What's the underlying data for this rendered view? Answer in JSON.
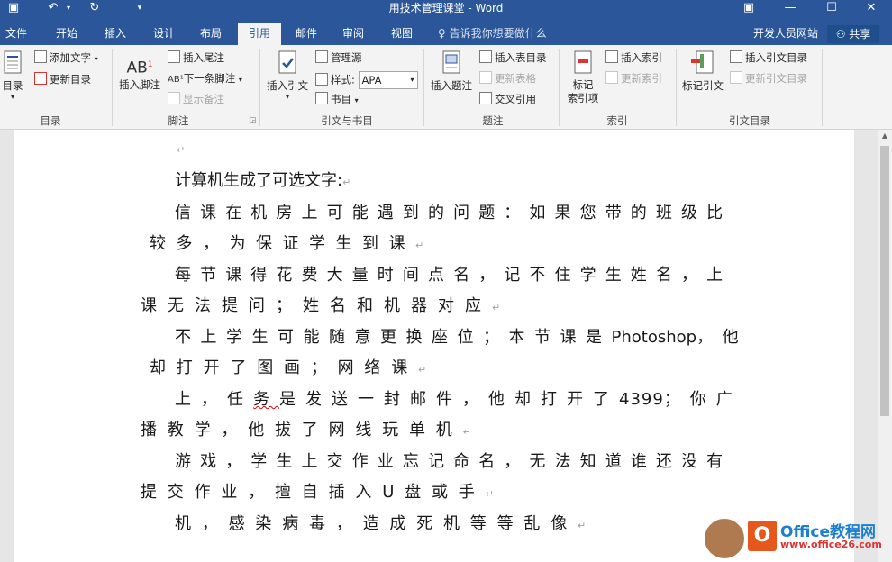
{
  "window": {
    "title": "用技术管理课堂 - Word",
    "minimize": "—",
    "restore": "☐",
    "close": "✕",
    "ribbon_display": "▣"
  },
  "tabs": {
    "file": "文件",
    "home": "开始",
    "insert": "插入",
    "design": "设计",
    "layout": "布局",
    "references": "引用",
    "mailings": "邮件",
    "review": "审阅",
    "view": "视图",
    "tell_me": "告诉我你想要做什么",
    "developer_site": "开发人员网站",
    "share": "共享"
  },
  "ribbon": {
    "toc": {
      "label": "目录",
      "toc_button": "目录",
      "add_text": "添加文字",
      "update_toc": "更新目录"
    },
    "footnotes": {
      "label": "脚注",
      "insert_footnote": "插入脚注",
      "insert_endnote": "插入尾注",
      "next_footnote": "下一条脚注",
      "show_notes": "显示备注"
    },
    "citations": {
      "label": "引文与书目",
      "insert_citation": "插入引文",
      "manage_sources": "管理源",
      "style_label": "样式:",
      "style_value": "APA",
      "bibliography": "书目"
    },
    "captions": {
      "label": "题注",
      "insert_caption": "插入题注",
      "insert_table_of_figures": "插入表目录",
      "update_table": "更新表格",
      "cross_reference": "交叉引用"
    },
    "index": {
      "label": "索引",
      "mark_entry_line1": "标记",
      "mark_entry_line2": "索引项",
      "insert_index": "插入索引",
      "update_index": "更新索引"
    },
    "toa": {
      "label": "引文目录",
      "mark_citation": "标记引文",
      "insert_toa": "插入引文目录",
      "update_toa": "更新引文目录"
    }
  },
  "document": {
    "mark": "↵",
    "lines": [
      "计算机生成了可选文字:",
      "信课在机房上可能遇到的问题：如果您带的班级比",
      "较多，为保证学生到课",
      "每节课得花费大量时间点名，记不住学生姓名，上",
      "课无法提问；姓名和机器对应",
      "不上学生可能随意更换座位；本节课是",
      "Photoshop",
      "，他",
      "却打开了图画；网络课",
      "上，任",
      "务",
      "是发送一封邮件，他却打开了",
      "4399",
      "；你广",
      "播教学，他拔了网线玩单机",
      "游戏，学生上交作业忘记命名，无法知道谁还没有",
      "提交作业，擅自插入",
      "U",
      "盘或手",
      "机，感染病毒，造成死机等等乱像"
    ]
  },
  "watermark": {
    "logo_letter": "O",
    "brand": "Office教程网",
    "url": "www.office26.com"
  },
  "colors": {
    "accent": "#2b579a",
    "ribbon_bg": "#f3f3f3",
    "page_bg": "#ffffff"
  }
}
